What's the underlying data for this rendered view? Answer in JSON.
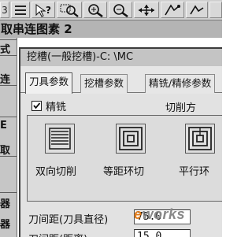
{
  "toolbar": {
    "icons": [
      "lines-icon",
      "help-cursor-icon",
      "zoom-window-icon",
      "zoom-in-icon",
      "zoom-out-icon",
      "pan-icon",
      "measure-icon"
    ],
    "first_label": "3"
  },
  "background": {
    "title": "取串连图素 2",
    "side_labels": [
      "式",
      "连",
      "E",
      "取",
      "器",
      "器"
    ]
  },
  "dialog": {
    "title": "挖槽(一般挖槽)-C: \\MC",
    "tabs": [
      "刀具参数",
      "挖槽参数",
      "精铣/精修参数"
    ],
    "active_tab": "刀具参数",
    "finish_check_label": "精铣",
    "finish_checked": true,
    "cut_method_label": "切削方",
    "methods": [
      {
        "label": "双向切削",
        "icon": "zigzag-icon"
      },
      {
        "label": "等距环切",
        "icon": "constant-overlap-spiral-icon"
      },
      {
        "label": "平行环",
        "icon": "parallel-spiral-icon"
      }
    ],
    "fields": [
      {
        "label": "刀间距(刀具直径)",
        "value": "75.0"
      },
      {
        "label": "刀间距(距离)",
        "value": "15.0"
      }
    ]
  },
  "watermark": {
    "prefix": "e",
    "main": "works",
    "cn": "e-works"
  }
}
